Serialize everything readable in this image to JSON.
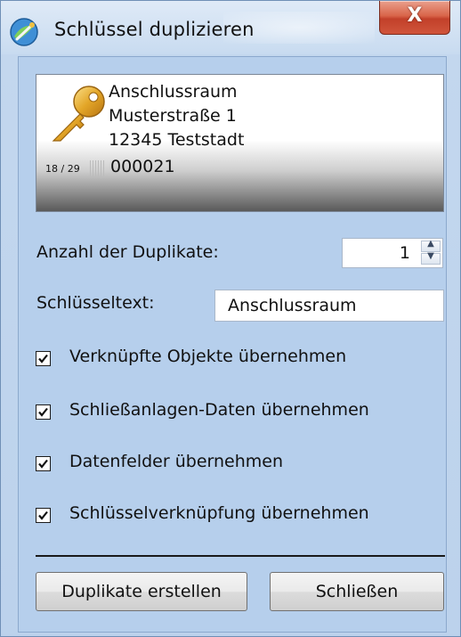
{
  "window": {
    "title": "Schlüssel duplizieren",
    "close_label": "X"
  },
  "key_card": {
    "icon": "key-icon",
    "lines": [
      "Anschlussraum",
      "Musterstraße 1",
      "12345 Teststadt"
    ],
    "count_label": "18 / 29",
    "key_number": "000021"
  },
  "form": {
    "duplicates_label": "Anzahl der Duplikate:",
    "duplicates_value": "1",
    "key_text_label": "Schlüsseltext:",
    "key_text_value": "Anschlussraum"
  },
  "options": [
    {
      "label": "Verknüpfte Objekte übernehmen",
      "checked": true
    },
    {
      "label": "Schließanlagen-Daten übernehmen",
      "checked": true
    },
    {
      "label": "Datenfelder übernehmen",
      "checked": true
    },
    {
      "label": "Schlüsselverknüpfung übernehmen",
      "checked": true
    }
  ],
  "buttons": {
    "create_label": "Duplikate erstellen",
    "close_label": "Schließen"
  },
  "colors": {
    "background": "#b6cfec",
    "close_button": "#c2402a",
    "key_gold": "#e0a52a"
  }
}
